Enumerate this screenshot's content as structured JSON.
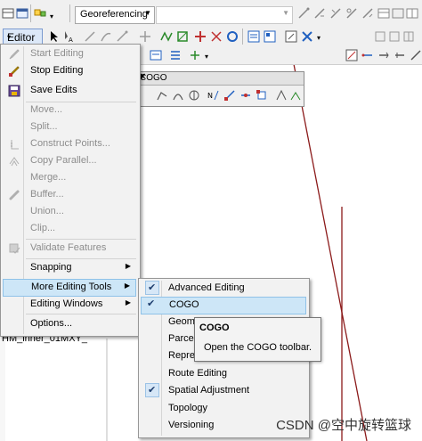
{
  "toolbar": {
    "georef_label": "Georeferencing",
    "editor_label": "Editor"
  },
  "cogo_toolbar": {
    "title": "COGO"
  },
  "editor_menu": {
    "items": [
      {
        "label": "Start Editing",
        "enabled": false,
        "icon": "pencil-icon"
      },
      {
        "label": "Stop Editing",
        "enabled": true,
        "icon": "pencil-stop-icon"
      },
      {
        "label": "Save Edits",
        "enabled": true,
        "icon": "save-icon"
      },
      {
        "label": "Move...",
        "enabled": false
      },
      {
        "label": "Split...",
        "enabled": false
      },
      {
        "label": "Construct Points...",
        "enabled": false,
        "icon": "construct-points-icon"
      },
      {
        "label": "Copy Parallel...",
        "enabled": false,
        "icon": "copy-parallel-icon"
      },
      {
        "label": "Merge...",
        "enabled": false
      },
      {
        "label": "Buffer...",
        "enabled": false,
        "icon": "buffer-icon"
      },
      {
        "label": "Union...",
        "enabled": false
      },
      {
        "label": "Clip...",
        "enabled": false
      },
      {
        "label": "Validate Features",
        "enabled": false,
        "icon": "validate-icon"
      },
      {
        "label": "Snapping",
        "enabled": true,
        "submenu": true
      },
      {
        "label": "More Editing Tools",
        "enabled": true,
        "submenu": true,
        "highlighted": true
      },
      {
        "label": "Editing Windows",
        "enabled": true,
        "submenu": true
      },
      {
        "label": "Options...",
        "enabled": true
      }
    ]
  },
  "submenu": {
    "items": [
      {
        "label": "Advanced Editing",
        "checked": true
      },
      {
        "label": "COGO",
        "checked": true,
        "highlighted": true
      },
      {
        "label": "Geometric Network Editing",
        "checked": false
      },
      {
        "label": "Parcel Editor",
        "checked": false
      },
      {
        "label": "Representation",
        "checked": false
      },
      {
        "label": "Route Editing",
        "checked": false
      },
      {
        "label": "Spatial Adjustment",
        "checked": true
      },
      {
        "label": "Topology",
        "checked": false
      },
      {
        "label": "Versioning",
        "checked": false
      }
    ]
  },
  "tooltip": {
    "title": "COGO",
    "description": "Open the COGO toolbar."
  },
  "layer_fragment": "HM_inner_01MXY_",
  "watermark": "CSDN @空中旋转篮球",
  "colors": {
    "map_line": "#8b1a1a",
    "menu_highlight": "#cde6f7"
  }
}
